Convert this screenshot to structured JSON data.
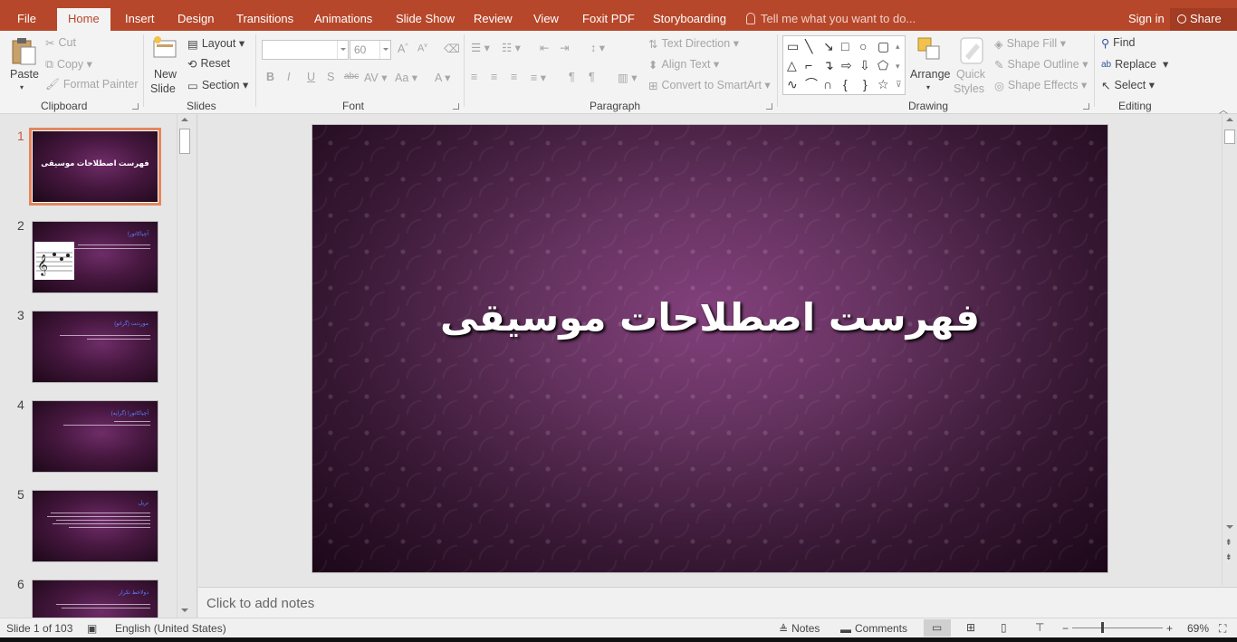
{
  "tabs": {
    "file": "File",
    "home": "Home",
    "insert": "Insert",
    "design": "Design",
    "transitions": "Transitions",
    "animations": "Animations",
    "slideshow": "Slide Show",
    "review": "Review",
    "view": "View",
    "foxit": "Foxit PDF",
    "storyboarding": "Storyboarding"
  },
  "tell_me": "Tell me what you want to do...",
  "sign_in": "Sign in",
  "share": "Share",
  "clipboard": {
    "paste": "Paste",
    "cut": "Cut",
    "copy": "Copy",
    "format_painter": "Format Painter",
    "label": "Clipboard"
  },
  "slides_group": {
    "new_slide_1": "New",
    "new_slide_2": "Slide",
    "layout": "Layout",
    "reset": "Reset",
    "section": "Section",
    "label": "Slides"
  },
  "font": {
    "name": "",
    "size": "60",
    "label": "Font"
  },
  "paragraph": {
    "text_direction": "Text Direction",
    "align_text": "Align Text",
    "convert_smartart": "Convert to SmartArt",
    "label": "Paragraph"
  },
  "drawing": {
    "arrange": "Arrange",
    "quick_styles_1": "Quick",
    "quick_styles_2": "Styles",
    "shape_fill": "Shape Fill",
    "shape_outline": "Shape Outline",
    "shape_effects": "Shape Effects",
    "label": "Drawing"
  },
  "editing": {
    "find": "Find",
    "replace": "Replace",
    "select": "Select",
    "label": "Editing"
  },
  "thumbnails": [
    {
      "num": "1",
      "title": "فهرست اصطلاحات موسیقی"
    },
    {
      "num": "2",
      "title": "آچیاکاتورا"
    },
    {
      "num": "3",
      "title": "موردنت (گراتو)"
    },
    {
      "num": "4",
      "title": "آچیاکاتورا (گراپه)"
    },
    {
      "num": "5",
      "title": "تریل"
    },
    {
      "num": "6",
      "title": "دولاخط تکرار"
    }
  ],
  "slide": {
    "title": "فهرست اصطلاحات موسیقی"
  },
  "notes_placeholder": "Click to add notes",
  "status": {
    "slide_info": "Slide 1 of 103",
    "language": "English (United States)",
    "notes": "Notes",
    "comments": "Comments",
    "zoom": "69%"
  },
  "colors": {
    "brand": "#b7472a",
    "selection": "#e5875e",
    "slide_bg": "#4a1a44"
  }
}
